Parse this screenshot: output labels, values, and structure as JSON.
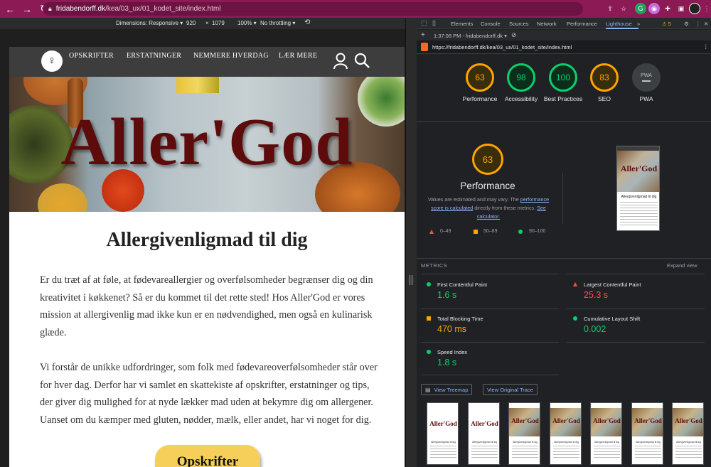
{
  "browser": {
    "url_domain": "fridabendorff.dk",
    "url_path": "/kea/03_ux/01_kodet_site/index.html"
  },
  "device_toolbar": {
    "dimensions": "Dimensions: Responsive ▾",
    "width": "920",
    "x": "×",
    "height": "1079",
    "zoom": "100% ▾",
    "throttle": "No throttling ▾"
  },
  "site": {
    "nav": [
      "OPSKRIFTER",
      "ERSTATNINGER",
      "NEMMERE HVERDAG",
      "LÆR MERE"
    ],
    "hero_title": "Aller'God",
    "heading": "Allergivenligmad til dig",
    "para1": "Er du træt af at føle, at fødevareallergier og overfølsomheder begrænser dig og din kreativitet i køkkenet? Så er du kommet til det rette sted! Hos Aller'God er vores mission at allergivenlig mad ikke kun er en nødvendighed, men også en kulinarisk glæde.",
    "para2": "Vi forstår de unikke udfordringer, som folk med fødevareoverfølsomheder står over for hver dag. Derfor har vi samlet en skattekiste af opskrifter, erstatninger og tips, der giver dig mulighed for at nyde lækker mad uden at bekymre dig om allergener. Uanset om du kæmper med gluten, nødder, mælk, eller andet, har vi noget for dig.",
    "cta": "Opskrifter"
  },
  "devtools": {
    "tabs": [
      "Elements",
      "Console",
      "Sources",
      "Network",
      "Performance",
      "Lighthouse",
      "»"
    ],
    "warnings": "⚠ 5",
    "session": "1:37:08 PM - fridabendorff.dk ▾",
    "report_url": "https://fridabendorff.dk/kea/03_ux/01_kodet_site/index.html",
    "scores": [
      {
        "label": "Performance",
        "value": "63",
        "color": "#ffa400"
      },
      {
        "label": "Accessibility",
        "value": "98",
        "color": "#0cce6b"
      },
      {
        "label": "Best Practices",
        "value": "100",
        "color": "#0cce6b"
      },
      {
        "label": "SEO",
        "value": "83",
        "color": "#ffa400"
      },
      {
        "label": "PWA",
        "value": "PWA",
        "color": "#9aa0a6"
      }
    ],
    "perf_score": "63",
    "perf_title": "Performance",
    "perf_note_1": "Values are estimated and may vary. The ",
    "perf_note_link1": "performance score is calculated",
    "perf_note_2": " directly from these metrics. ",
    "perf_note_link2": "See calculator.",
    "legend": [
      "0–49",
      "50–89",
      "90–100"
    ],
    "metrics_header": "METRICS",
    "expand": "Expand view",
    "metrics": [
      {
        "title": "First Contentful Paint",
        "value": "1.6 s",
        "status": "good"
      },
      {
        "title": "Largest Contentful Paint",
        "value": "25.3 s",
        "status": "poor"
      },
      {
        "title": "Total Blocking Time",
        "value": "470 ms",
        "status": "average"
      },
      {
        "title": "Cumulative Layout Shift",
        "value": "0.002",
        "status": "good"
      },
      {
        "title": "Speed Index",
        "value": "1.8 s",
        "status": "good"
      }
    ],
    "view_treemap": "View Treemap",
    "view_trace": "View Original Trace",
    "thumb_title": "Aller'God",
    "thumb_sub": "Allergivenligmad til dig"
  },
  "colors": {
    "good": "#0cce6b",
    "average": "#ffa400",
    "poor": "#ff4e42",
    "chrome_bar": "#8b1a55"
  }
}
